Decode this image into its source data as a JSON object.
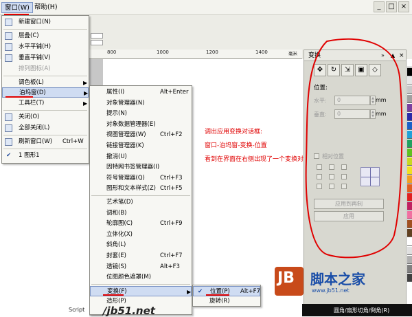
{
  "menubar": {
    "window": "窗口(W)",
    "help": "帮助(H)"
  },
  "window_buttons": [
    "_",
    "□",
    "×"
  ],
  "ruler": {
    "ticks": [
      "800",
      "1000",
      "1200",
      "1400"
    ],
    "unit": "毫米"
  },
  "window_menu": {
    "items": [
      {
        "label": "新建窗口(N)",
        "icon": "new-window-icon"
      },
      {
        "label": "层叠(C)",
        "icon": "cascade-icon"
      },
      {
        "label": "水平平铺(H)",
        "icon": "tile-horizontal-icon"
      },
      {
        "label": "垂直平铺(V)",
        "icon": "tile-vertical-icon"
      },
      {
        "label": "排列图标(A)",
        "disabled": true
      },
      {
        "label": "调色板(L)",
        "submenu": true
      },
      {
        "label": "泊坞窗(D)",
        "submenu": true,
        "active": true
      },
      {
        "label": "工具栏(T)",
        "submenu": true
      },
      {
        "label": "关闭(O)",
        "icon": "close-doc-icon"
      },
      {
        "label": "全部关闭(L)",
        "icon": "close-all-icon"
      },
      {
        "label": "刷新窗口(W)",
        "shortcut": "Ctrl+W",
        "icon": "refresh-icon"
      },
      {
        "label": "1 图形1",
        "checked": true
      }
    ]
  },
  "docker_menu": {
    "items": [
      {
        "label": "属性(I)",
        "shortcut": "Alt+Enter"
      },
      {
        "label": "对象管理器(N)"
      },
      {
        "label": "提示(N)"
      },
      {
        "label": "对象数据管理器(E)"
      },
      {
        "label": "视图管理器(W)",
        "shortcut": "Ctrl+F2"
      },
      {
        "label": "链接管理器(K)"
      },
      {
        "label": "撤消(U)"
      },
      {
        "label": "因特网书签管理器(I)"
      },
      {
        "label": "符号管理器(Q)",
        "shortcut": "Ctrl+F3"
      },
      {
        "label": "图形和文本样式(Z)",
        "shortcut": "Ctrl+F5"
      },
      {
        "label": "艺术笔(D)"
      },
      {
        "label": "调和(B)"
      },
      {
        "label": "轮廓图(C)",
        "shortcut": "Ctrl+F9"
      },
      {
        "label": "立体化(X)"
      },
      {
        "label": "斜角(L)"
      },
      {
        "label": "封套(E)",
        "shortcut": "Ctrl+F7"
      },
      {
        "label": "透镜(S)",
        "shortcut": "Alt+F3"
      },
      {
        "label": "位图颜色遮罩(M)"
      },
      {
        "label": "变换(F)",
        "submenu": true,
        "active": true
      },
      {
        "label": "造形(P)"
      }
    ]
  },
  "transform_menu": {
    "items": [
      {
        "label": "位置(P)",
        "shortcut": "Alt+F7",
        "checked": true,
        "active": true
      },
      {
        "label": "旋转(R)"
      }
    ]
  },
  "annotations": [
    "调出应用变换对话框:",
    "窗口-泊坞窗-变换-位置",
    "看到在界面在右侧出现了一个变换对话框"
  ],
  "docker": {
    "title": "变换",
    "position_label": "位置:",
    "h_label": "水平:",
    "h_value": "0",
    "v_label": "垂直:",
    "v_value": "0",
    "unit": "mm",
    "relative_label": "相对位置",
    "apply_duplicate": "应用到再制",
    "apply": "应用"
  },
  "statusbar_text": "圆角/扇形切角/倒角(R)",
  "footer": {
    "script": "Script",
    "url": "/jb51.net"
  },
  "watermark": {
    "logo": "JB",
    "text": "脚本之家",
    "url": "www.jb51.net"
  },
  "colors": {
    "accent_red": "#e00000",
    "menu_highlight": "#cfdcf2",
    "watermark_blue": "#1a4ea8"
  },
  "palette": [
    "#ffffff",
    "#000000",
    "#e8e8e8",
    "#c8c8c8",
    "#a0a0a0",
    "#7a3fa0",
    "#2a2aa8",
    "#1a60c8",
    "#20a0d8",
    "#20a060",
    "#60c020",
    "#c8d820",
    "#f0e020",
    "#f0a020",
    "#e06020",
    "#e02020",
    "#c02060",
    "#f070a0",
    "#a05020",
    "#604020",
    "#ffffff",
    "#e0e0e0",
    "#b0b0b0",
    "#808080",
    "#404040"
  ]
}
